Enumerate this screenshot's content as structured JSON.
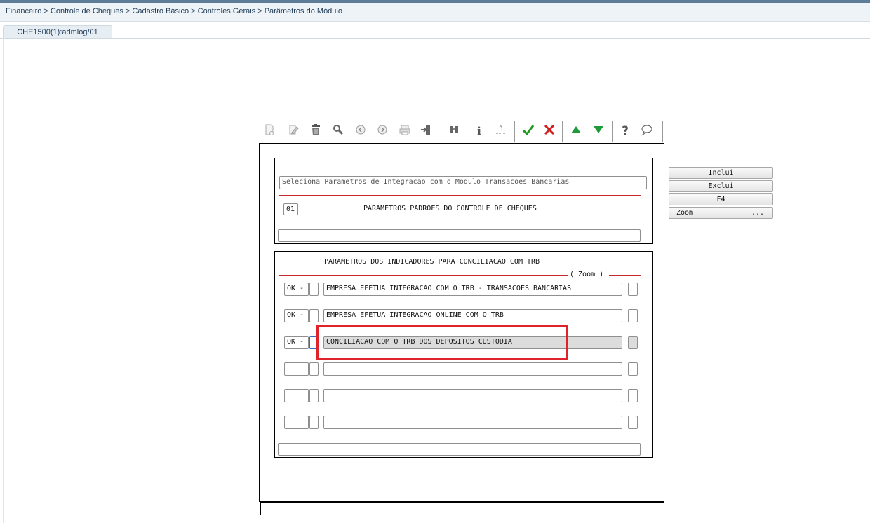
{
  "breadcrumb": "Financeiro > Controle de Cheques > Cadastro Básico > Controles Gerais > Parâmetros do Módulo",
  "tab": {
    "label": "CHE1500(1):admlog/01"
  },
  "toolbar": {
    "icons": [
      "new-doc-icon",
      "edit-icon",
      "trash-icon",
      "search-icon",
      "prev-icon",
      "next-icon",
      "print-icon",
      "exit-icon",
      "binoculars-icon",
      "info-icon",
      "numbered-list-icon",
      "confirm-icon",
      "cancel-icon",
      "up-icon",
      "down-icon",
      "help-icon",
      "comment-icon"
    ]
  },
  "header_panel": {
    "title_field": "Seleciona Parametros de Integracao com o Modulo Transacoes Bancarias",
    "code": "01",
    "heading": "PARAMETROS PADROES DO CONTROLE DE CHEQUES",
    "bottom_field": ""
  },
  "indicators_panel": {
    "heading": "PARAMETROS DOS INDICADORES PARA CONCILIACAO COM TRB",
    "zoom_label": "( Zoom )",
    "rows": [
      {
        "status": "OK -",
        "description": "EMPRESA EFETUA INTEGRACAO COM O TRB - TRANSACOES BANCARIAS"
      },
      {
        "status": "OK -",
        "description": "EMPRESA EFETUA INTEGRACAO ONLINE COM O TRB"
      },
      {
        "status": "OK -",
        "description": "CONCILIACAO COM O TRB DOS DEPOSITOS CUSTODIA"
      },
      {
        "status": "",
        "description": ""
      },
      {
        "status": "",
        "description": ""
      },
      {
        "status": "",
        "description": ""
      }
    ],
    "bottom_field": ""
  },
  "side_buttons": {
    "inclui": "Inclui",
    "exclui": "Exclui",
    "f4": "F4",
    "zoom": "Zoom",
    "zoom_dots": "..."
  },
  "colors": {
    "highlight": "#e0222b",
    "confirm": "#1f9a1f",
    "cancel": "#d01f1f",
    "arrows": "#1f9a3a"
  }
}
